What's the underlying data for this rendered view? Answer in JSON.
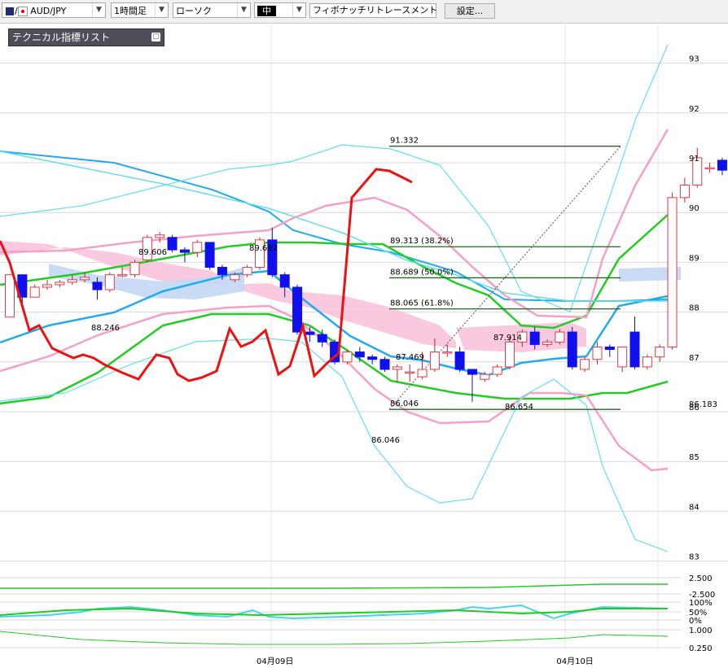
{
  "toolbar": {
    "symbol": "AUD/JPY",
    "timeframe": "1時間足",
    "chart_style": "ローソク",
    "size": "中",
    "tool": "フィボナッチリトレースメント",
    "settings": "設定..."
  },
  "indicator_panel": {
    "title": "テクニカル指標リスト"
  },
  "colors": {
    "bull": "#e03a4a",
    "bear": "#1010ee",
    "line_red": "#ee1111",
    "bollinger_mid": "#22cc22",
    "bollinger_inner": "#f4a0c8",
    "bollinger_outer": "#66ddee",
    "ma": "#22aaee",
    "cloud_bull": "#f8c4dc",
    "cloud_bear": "#c4d8f4",
    "fib": "#226622"
  },
  "chart_data": {
    "type": "candlestick",
    "ylim": [
      82.6,
      93.55
    ],
    "y_ticks": [
      "93",
      "92",
      "91",
      "90",
      "89",
      "88",
      "87",
      "86",
      "85",
      "84",
      "83"
    ],
    "x_labels": [
      {
        "text": "04月09日",
        "index": 22
      },
      {
        "text": "04月10日",
        "index": 46
      }
    ],
    "candles": [
      [
        87.9,
        88.75,
        88.05,
        88.75
      ],
      [
        88.75,
        88.3,
        88.15,
        88.75
      ],
      [
        88.3,
        88.5,
        88.3,
        88.55
      ],
      [
        88.5,
        88.55,
        88.45,
        88.65
      ],
      [
        88.55,
        88.6,
        88.5,
        88.65
      ],
      [
        88.6,
        88.65,
        88.55,
        88.75
      ],
      [
        88.65,
        88.7,
        88.6,
        88.8
      ],
      [
        88.6,
        88.45,
        88.25,
        88.7
      ],
      [
        88.45,
        88.75,
        88.4,
        88.8
      ],
      [
        88.75,
        88.75,
        88.7,
        88.9
      ],
      [
        88.75,
        89.0,
        88.7,
        89.05
      ],
      [
        89.05,
        89.5,
        89.0,
        89.55
      ],
      [
        89.5,
        89.55,
        89.4,
        89.61
      ],
      [
        89.5,
        89.25,
        89.2,
        89.55
      ],
      [
        89.25,
        89.2,
        89.0,
        89.3
      ],
      [
        89.2,
        89.4,
        89.1,
        89.45
      ],
      [
        89.4,
        88.9,
        88.85,
        89.4
      ],
      [
        88.9,
        88.75,
        88.65,
        88.95
      ],
      [
        88.65,
        88.75,
        88.6,
        88.8
      ],
      [
        88.75,
        88.9,
        88.7,
        88.95
      ],
      [
        88.9,
        89.45,
        88.85,
        89.5
      ],
      [
        89.45,
        88.75,
        88.7,
        89.69
      ],
      [
        88.75,
        88.5,
        88.3,
        88.8
      ],
      [
        88.5,
        87.6,
        87.55,
        88.55
      ],
      [
        87.6,
        87.55,
        87.4,
        87.7
      ],
      [
        87.55,
        87.4,
        87.3,
        87.65
      ],
      [
        87.4,
        87.0,
        86.95,
        87.45
      ],
      [
        87.0,
        87.2,
        86.95,
        87.25
      ],
      [
        87.2,
        87.1,
        87.0,
        87.3
      ],
      [
        87.1,
        87.05,
        86.95,
        87.15
      ],
      [
        87.05,
        86.85,
        86.8,
        87.1
      ],
      [
        86.85,
        86.9,
        86.6,
        86.95
      ],
      [
        86.8,
        86.8,
        86.6,
        86.95
      ],
      [
        86.7,
        86.85,
        86.65,
        87.2
      ],
      [
        86.85,
        87.2,
        86.8,
        87.47
      ],
      [
        87.2,
        87.2,
        87.1,
        87.35
      ],
      [
        87.2,
        86.85,
        86.8,
        87.3
      ],
      [
        86.85,
        86.75,
        86.2,
        86.85
      ],
      [
        86.65,
        86.75,
        86.6,
        86.8
      ],
      [
        86.75,
        86.9,
        86.7,
        86.95
      ],
      [
        86.9,
        87.4,
        86.85,
        87.5
      ],
      [
        87.4,
        87.6,
        87.3,
        87.65
      ],
      [
        87.6,
        87.35,
        87.25,
        87.7
      ],
      [
        87.35,
        87.4,
        87.3,
        87.45
      ],
      [
        87.4,
        87.6,
        87.35,
        87.66
      ],
      [
        87.6,
        86.9,
        86.85,
        87.7
      ],
      [
        86.85,
        87.05,
        86.8,
        87.1
      ],
      [
        87.05,
        87.3,
        86.95,
        87.4
      ],
      [
        87.3,
        87.25,
        87.1,
        87.35
      ],
      [
        86.9,
        87.3,
        86.8,
        87.31
      ],
      [
        87.6,
        86.9,
        86.85,
        87.914
      ],
      [
        86.9,
        87.1,
        86.85,
        87.15
      ],
      [
        87.1,
        87.3,
        87.0,
        87.35
      ],
      [
        87.3,
        90.3,
        87.25,
        90.4
      ],
      [
        90.3,
        90.55,
        90.2,
        90.7
      ],
      [
        90.55,
        91.1,
        90.5,
        91.3
      ],
      [
        90.9,
        90.9,
        90.8,
        91.0
      ],
      [
        91.05,
        90.85,
        90.75,
        91.1
      ],
      [
        90.8,
        90.7,
        90.6,
        90.8
      ],
      [
        90.7,
        90.65,
        90.55,
        90.75
      ]
    ],
    "price_labels": [
      {
        "text": "89.606",
        "value": 89.606
      },
      {
        "text": "89.692",
        "value": 89.692
      },
      {
        "text": "88.246",
        "value": 88.246
      },
      {
        "text": "87.469",
        "value": 87.469
      },
      {
        "text": "86.046",
        "value": 86.046
      },
      {
        "text": "87.914",
        "value": 87.914
      },
      {
        "text": "86.654",
        "value": 86.654
      },
      {
        "text": "86.183",
        "value": 86.183
      }
    ],
    "fibonacci": [
      {
        "label": "91.332",
        "value": 91.332
      },
      {
        "label": "89.313 (38.2%)",
        "value": 89.313
      },
      {
        "label": "88.689 (50.0%)",
        "value": 88.689
      },
      {
        "label": "88.065 (61.8%)",
        "value": 88.065
      },
      {
        "label": "86.046",
        "value": 86.046
      }
    ],
    "oscillator_labels": [
      "2.500",
      "-2.500",
      "100%",
      "50%",
      "0%",
      "1.000",
      "0.250"
    ]
  }
}
